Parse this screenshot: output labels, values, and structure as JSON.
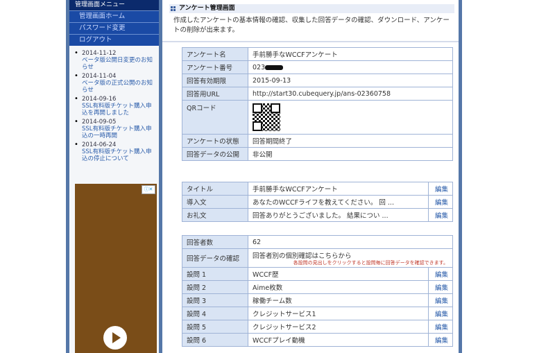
{
  "sidebar": {
    "title": "管理画面メニュー",
    "items": [
      {
        "label": "管理画面ホーム"
      },
      {
        "label": "パスワード変更"
      },
      {
        "label": "ログアウト"
      }
    ],
    "news": [
      {
        "date": "2014-11-12",
        "text": "ベータ版公開日変更のお知らせ"
      },
      {
        "date": "2014-11-04",
        "text": "ベータ版の正式公開のお知らせ"
      },
      {
        "date": "2014-09-16",
        "text": "SSL有料版チケット購入申込を再開しました"
      },
      {
        "date": "2014-09-05",
        "text": "SSL有料版チケット購入申込の一時再開"
      },
      {
        "date": "2014-06-24",
        "text": "SSL有料版チケット購入申込の停止について"
      }
    ]
  },
  "main": {
    "title": "アンケート管理画面",
    "description": "作成したアンケートの基本情報の確認、収集した回答データの確認、ダウンロード、アンケートの削除が出来ます。",
    "info": {
      "name_label": "アンケート名",
      "name_value": "手前勝手なWCCFアンケート",
      "number_label": "アンケート番号",
      "number_value": "023",
      "expiry_label": "回答有効期限",
      "expiry_value": "2015-09-13",
      "url_label": "回答用URL",
      "url_value": "http://start30.cubequery.jp/ans-02360758",
      "qr_label": "QRコード",
      "status_label": "アンケートの状態",
      "status_value": "回答期間終了",
      "public_label": "回答データの公開",
      "public_value": "非公開"
    },
    "texts": {
      "edit": "編集",
      "title_label": "タイトル",
      "title_value": "手前勝手なWCCFアンケート",
      "intro_label": "導入文",
      "intro_value": "あなたのWCCFライフを教えてください。 回 ...",
      "thanks_label": "お礼文",
      "thanks_value": "回答ありがとうございました。 結果につい ..."
    },
    "answers": {
      "count_label": "回答者数",
      "count_value": "62",
      "check_label": "回答データの確認",
      "check_value": "回答者別の個別確認はこちらから",
      "check_note": "各設問の見出しをクリックすると設問毎に回答データを確認できます。",
      "questions": [
        {
          "label": "設問 1",
          "value": "WCCF歴"
        },
        {
          "label": "設問 2",
          "value": "Aime枚数"
        },
        {
          "label": "設問 3",
          "value": "稼働チーム数"
        },
        {
          "label": "設問 4",
          "value": "クレジットサービス1"
        },
        {
          "label": "設問 5",
          "value": "クレジットサービス2"
        },
        {
          "label": "設問 6",
          "value": "WCCFプレイ動機"
        }
      ]
    }
  },
  "colors": {
    "frame": "#5577a8",
    "menu_title": "#0b2a6c",
    "menu_item": "#1a4aa5",
    "label_bg": "#d9e4f4",
    "border": "#9fb3d6"
  }
}
